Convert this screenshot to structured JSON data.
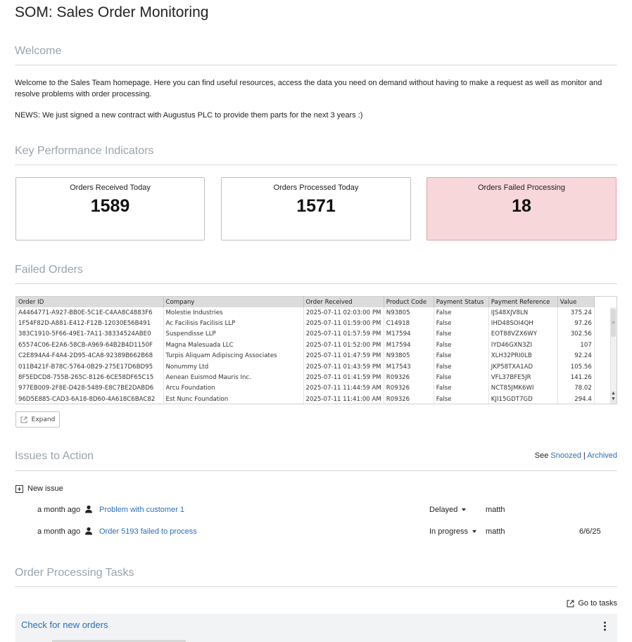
{
  "page": {
    "title": "SOM: Sales Order Monitoring"
  },
  "welcome": {
    "heading": "Welcome",
    "text": "Welcome to the Sales Team homepage. Here you can find useful resources, access the data you need on demand without having to make a request as well as monitor and resolve problems with order processing.",
    "news": "NEWS: We just signed a new contract with Augustus PLC to provide them parts for the next 3 years :)"
  },
  "kpi": {
    "heading": "Key Performance Indicators",
    "cards": [
      {
        "label": "Orders Received Today",
        "value": "1589"
      },
      {
        "label": "Orders Processed Today",
        "value": "1571"
      },
      {
        "label": "Orders Failed Processing",
        "value": "18"
      }
    ],
    "failed_color": "#f8d7da"
  },
  "failed_orders": {
    "heading": "Failed Orders",
    "columns": [
      "Order ID",
      "Company",
      "Order Received",
      "Product Code",
      "Payment Status",
      "Payment Reference",
      "Value"
    ],
    "rows": [
      [
        "A4464771-A927-BB0E-5C1E-C4AA8C4883F6",
        "Molestie Industries",
        "2025-07-11 02:03:00 PM",
        "N93805",
        "False",
        "IJS48XJV8LN",
        "375.24"
      ],
      [
        "1F54F82D-A881-E412-F12B-12030E56B491",
        "Ac Facilisis Facilisis LLP",
        "2025-07-11 01:59:00 PM",
        "C14918",
        "False",
        "IHD48SOI4QH",
        "97.26"
      ],
      [
        "383C1910-5F66-49E1-7A11-38334524ABE0",
        "Suspendisse LLP",
        "2025-07-11 01:57:59 PM",
        "M17594",
        "False",
        "EOT88VZX6WY",
        "302.56"
      ],
      [
        "65574C06-E2A6-58CB-A969-64B2B4D1150F",
        "Magna Malesuada LLC",
        "2025-07-11 01:52:00 PM",
        "M17594",
        "False",
        "IYD46GXN3ZI",
        "107"
      ],
      [
        "C2E894A4-F4A4-2D95-4CA8-92389B662B68",
        "Turpis Aliquam Adipiscing Associates",
        "2025-07-11 01:47:59 PM",
        "N93805",
        "False",
        "XLH32PRI0LB",
        "92.24"
      ],
      [
        "011B421F-B78C-5764-0B29-275E17D6BD95",
        "Nonummy Ltd",
        "2025-07-11 01:43:59 PM",
        "M17543",
        "False",
        "JKP58TXA1AD",
        "105.56"
      ],
      [
        "8F5EDCD8-755B-265C-8126-6CE58DF65C15",
        "Aenean Euismod Mauris Inc.",
        "2025-07-11 01:41:59 PM",
        "R09326",
        "False",
        "VFL37BFE5JR",
        "141.26"
      ],
      [
        "977EB009-2F8E-D428-5489-E8C7BE2DABD6",
        "Arcu Foundation",
        "2025-07-11 11:44:59 AM",
        "R09326",
        "False",
        "NCT85JMK6WI",
        "78.02"
      ],
      [
        "96D5E885-CAD3-6A18-8D60-4A618C6BAC82",
        "Est Nunc Foundation",
        "2025-07-11 11:41:00 AM",
        "R09326",
        "False",
        "KJI15GDT7GD",
        "294.4"
      ]
    ],
    "expand_label": "Expand"
  },
  "issues": {
    "heading": "Issues to Action",
    "see_label": "See",
    "snoozed_label": "Snoozed",
    "separator": "|",
    "archived_label": "Archived",
    "new_issue_label": "New issue",
    "items": [
      {
        "time": "a month ago",
        "title": "Problem with customer 1",
        "status": "Delayed",
        "user": "matth",
        "date": ""
      },
      {
        "time": "a month ago",
        "title": "Order 5193 failed to process",
        "status": "In progress",
        "user": "matth",
        "date": "6/6/25"
      }
    ]
  },
  "tasks": {
    "heading": "Order Processing Tasks",
    "goto_label": "Go to tasks",
    "items": [
      {
        "title": "Check for new orders"
      }
    ]
  }
}
